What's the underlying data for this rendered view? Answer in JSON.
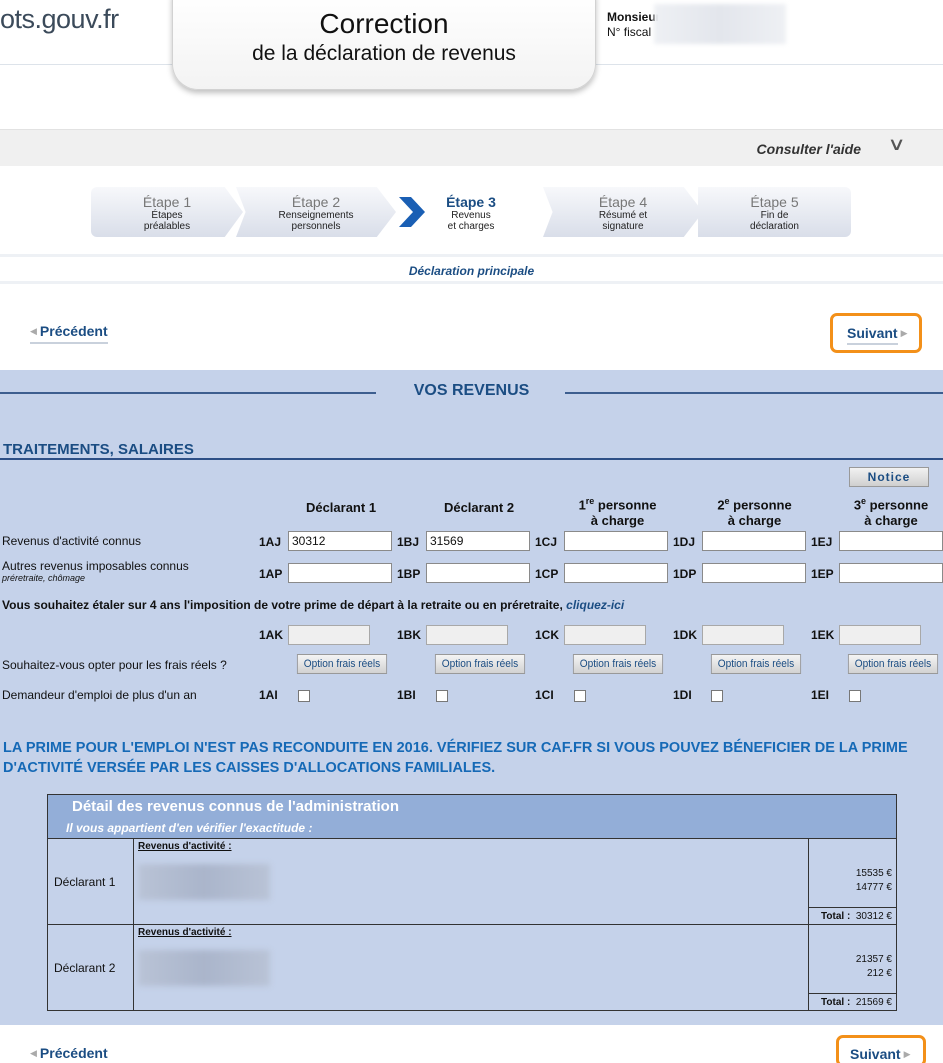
{
  "header": {
    "logo": "ots.gouv.fr",
    "title": "Correction",
    "subtitle": "de la déclaration de revenus",
    "user_line1": "Monsieur",
    "user_line2": "N° fiscal",
    "help_label": "Consulter l'aide"
  },
  "steps": [
    {
      "name": "Étape 1",
      "desc1": "Étapes",
      "desc2": "préalables"
    },
    {
      "name": "Étape 2",
      "desc1": "Renseignements",
      "desc2": "personnels"
    },
    {
      "name": "Étape 3",
      "desc1": "Revenus",
      "desc2": "et charges"
    },
    {
      "name": "Étape 4",
      "desc1": "Résumé et",
      "desc2": "signature"
    },
    {
      "name": "Étape 5",
      "desc1": "Fin de",
      "desc2": "déclaration"
    }
  ],
  "active_step": 3,
  "declaration_label": "Déclaration principale",
  "nav": {
    "prev": "Précédent",
    "next": "Suivant"
  },
  "section_title": "VOS REVENUS",
  "subsection_title": "TRAITEMENTS, SALAIRES",
  "notice_label": "Notice",
  "columns": {
    "d1": "Déclarant 1",
    "d2": "Déclarant 2",
    "p1_num": "1",
    "p1_sup": "re",
    "p1_rest": " personne",
    "p2_num": "2",
    "p2_sup": "e",
    "p2_rest": " personne",
    "p3_num": "3",
    "p3_sup": "e",
    "p3_rest": " personne",
    "charge": "à charge"
  },
  "rows": {
    "revenus_label": "Revenus d'activité connus",
    "revenus_codes": [
      "1AJ",
      "1BJ",
      "1CJ",
      "1DJ",
      "1EJ"
    ],
    "revenus_values": [
      "30312",
      "31569",
      "",
      "",
      ""
    ],
    "autres_label": "Autres revenus imposables connus",
    "autres_sublabel": "préretraite, chômage",
    "autres_codes": [
      "1AP",
      "1BP",
      "1CP",
      "1DP",
      "1EP"
    ],
    "etaler_text": "Vous souhaitez étaler sur 4 ans l'imposition de votre prime de départ à la retraite ou en préretraite, ",
    "etaler_link": "cliquez-ici",
    "prime_codes": [
      "1AK",
      "1BK",
      "1CK",
      "1DK",
      "1EK"
    ],
    "frais_label": "Souhaitez-vous opter pour les frais réels ?",
    "frais_button": "Option frais réels",
    "emploi_label": "Demandeur d'emploi de plus d'un an",
    "emploi_codes": [
      "1AI",
      "1BI",
      "1CI",
      "1DI",
      "1EI"
    ]
  },
  "prime_message": "LA PRIME POUR L'EMPLOI N'EST PAS RECONDUITE EN 2016. VÉRIFIEZ SUR CAF.FR SI VOUS POUVEZ BÉNEFICIER DE LA PRIME D'ACTIVITÉ VERSÉE PAR LES CAISSES D'ALLOCATIONS FAMILIALES.",
  "detail": {
    "title": "Détail des revenus connus de l'administration",
    "subtitle": "Il vous appartient d'en vérifier l'exactitude :",
    "category": "Revenus d'activité :",
    "total_label": "Total :",
    "declarant1": {
      "label": "Déclarant 1",
      "amounts": [
        "15535 €",
        "14777 €"
      ],
      "total": "30312 €"
    },
    "declarant2": {
      "label": "Déclarant 2",
      "amounts": [
        "21357 €",
        "212 €"
      ],
      "total": "21569 €"
    }
  },
  "colors": {
    "accent": "#1b4d83",
    "highlight": "#f39019",
    "form_bg": "#c5d2ea",
    "message": "#1569b6"
  }
}
